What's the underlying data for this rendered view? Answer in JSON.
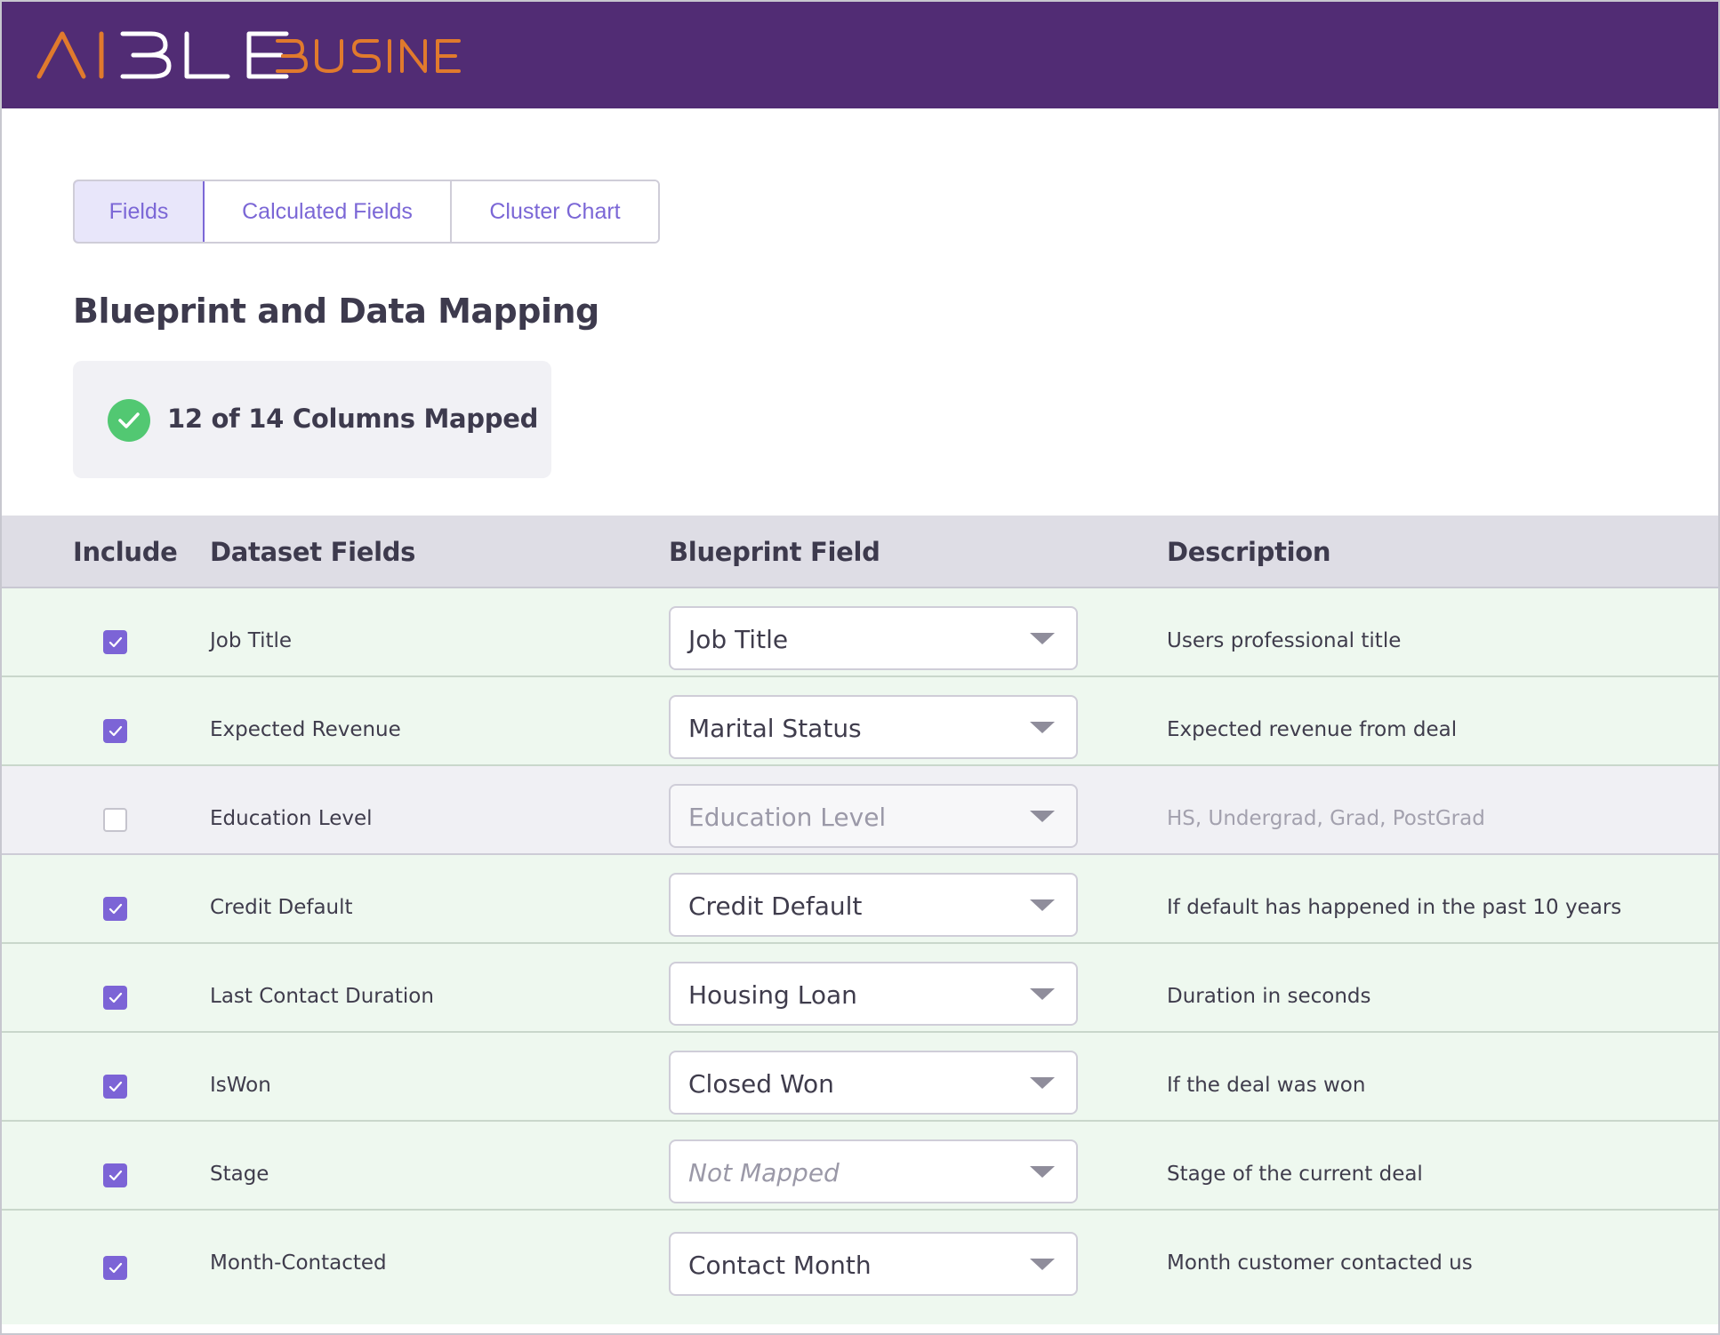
{
  "app": {
    "logo_text": "AIBLE BUSINESS",
    "brand_color": "#512c74",
    "logo_color": "#e07a2d"
  },
  "tabs": [
    {
      "label": "Fields",
      "active": true
    },
    {
      "label": "Calculated Fields",
      "active": false
    },
    {
      "label": "Cluster Chart",
      "active": false
    }
  ],
  "page": {
    "title": "Blueprint and Data Mapping"
  },
  "status": {
    "text": "12 of 14 Columns Mapped",
    "icon": "check-circle-icon",
    "color": "#52c872"
  },
  "table": {
    "headers": {
      "include": "Include",
      "dataset": "Dataset Fields",
      "blueprint": "Blueprint Field",
      "description": "Description"
    },
    "rows": [
      {
        "include": true,
        "dataset": "Job Title",
        "blueprint": "Job Title",
        "description": "Users professional title"
      },
      {
        "include": true,
        "dataset": "Expected Revenue",
        "blueprint": "Marital Status",
        "description": "Expected revenue from deal"
      },
      {
        "include": false,
        "dataset": "Education Level",
        "blueprint": "Education Level",
        "description": "HS, Undergrad, Grad, PostGrad"
      },
      {
        "include": true,
        "dataset": "Credit Default",
        "blueprint": "Credit Default",
        "description": "If default has happened in the past 10 years"
      },
      {
        "include": true,
        "dataset": "Last Contact Duration",
        "blueprint": "Housing Loan",
        "description": "Duration in seconds"
      },
      {
        "include": true,
        "dataset": "IsWon",
        "blueprint": "Closed Won",
        "description": "If the deal was won"
      },
      {
        "include": true,
        "dataset": "Stage",
        "blueprint": "Not Mapped",
        "blueprint_placeholder": true,
        "description": "Stage of the current deal"
      },
      {
        "include": true,
        "dataset": "Month-Contacted",
        "blueprint": "Contact Month",
        "description": "Month customer contacted us"
      }
    ]
  }
}
